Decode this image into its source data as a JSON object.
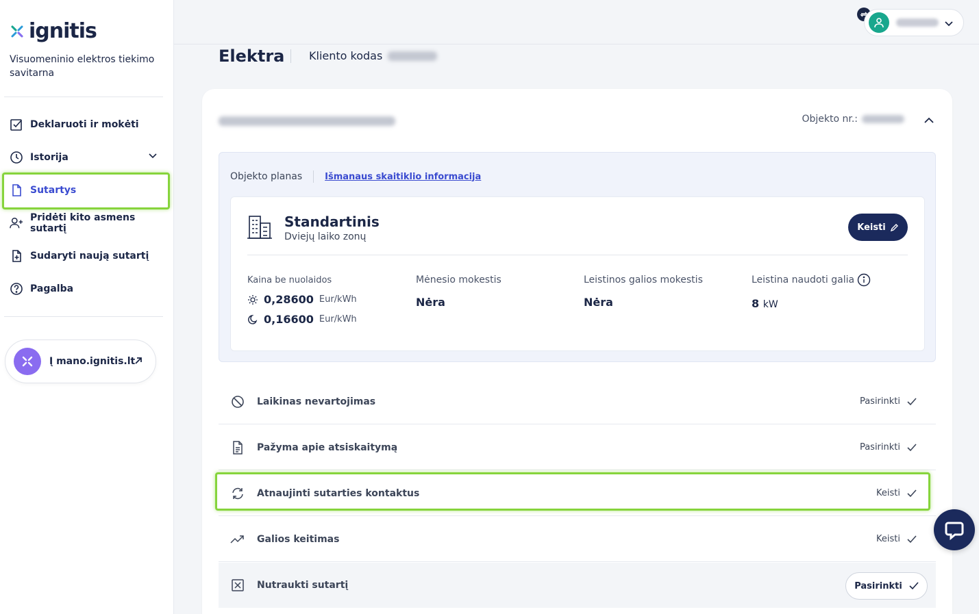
{
  "brand": {
    "name": "ignitis",
    "tagline": "Visuomeninio elektros tiekimo savitarna"
  },
  "nav": {
    "items": [
      {
        "label": "Deklaruoti ir mokėti",
        "icon": "checkbox-edit-icon"
      },
      {
        "label": "Istorija",
        "icon": "clock-icon"
      },
      {
        "label": "Sutartys",
        "icon": "document-icon"
      },
      {
        "label": "Pridėti kito asmens sutartį",
        "icon": "user-plus-icon"
      },
      {
        "label": "Sudaryti naują sutartį",
        "icon": "document-plus-icon"
      },
      {
        "label": "Pagalba",
        "icon": "help-icon"
      }
    ],
    "active": "Sutartys"
  },
  "mano": {
    "label": "Į mano.ignitis.lt"
  },
  "header": {
    "title": "Elektra",
    "client_code_label": "Kliento kodas"
  },
  "card": {
    "object_nr_label": "Objekto nr.:",
    "tabs": {
      "plan": "Objekto planas",
      "meter": "Išmanaus skaitiklio informacija"
    },
    "plan": {
      "name": "Standartinis",
      "subtitle": "Dviejų laiko zonų",
      "change_label": "Keisti",
      "price_label": "Kaina be nuolaidos",
      "day_price": "0,28600",
      "night_price": "0,16600",
      "price_unit": "Eur/kWh",
      "monthly_fee_label": "Mėnesio mokestis",
      "monthly_fee_value": "Nėra",
      "power_fee_label": "Leistinos galios mokestis",
      "power_fee_value": "Nėra",
      "allowed_power_label": "Leistina naudoti galia",
      "allowed_power_value": "8",
      "allowed_power_unit": "kW"
    },
    "options": [
      {
        "label": "Laikinas nevartojimas",
        "action": "Pasirinkti",
        "icon": "ban-icon"
      },
      {
        "label": "Pažyma apie atsiskaitymą",
        "action": "Pasirinkti",
        "icon": "file-text-icon"
      },
      {
        "label": "Atnaujinti sutarties kontaktus",
        "action": "Keisti",
        "icon": "refresh-icon"
      },
      {
        "label": "Galios keitimas",
        "action": "Keisti",
        "icon": "trend-up-icon"
      },
      {
        "label": "Nutraukti sutartį",
        "action": "Pasirinkti",
        "icon": "close-box-icon"
      }
    ]
  },
  "colors": {
    "navy": "#1b2a5c",
    "accent": "#3a4bd0",
    "highlight": "#86d43c",
    "avatar": "#19a78d"
  }
}
